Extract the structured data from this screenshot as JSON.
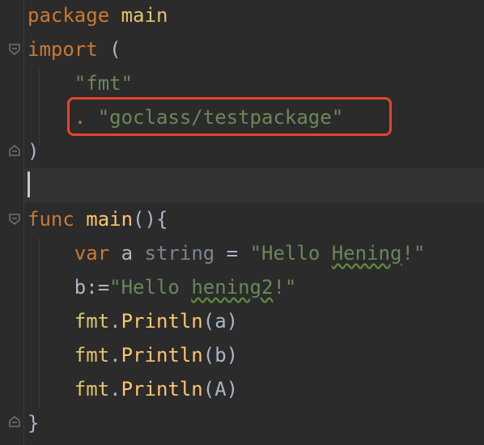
{
  "editor": {
    "language": "Go",
    "lines": {
      "l1": {
        "kw": "package",
        "name": "main"
      },
      "l2": {
        "kw": "import",
        "paren": "("
      },
      "l3": {
        "str": "\"fmt\""
      },
      "l4": {
        "dot": ".",
        "str": "\"goclass/testpackage\""
      },
      "l5": {
        "paren": ")"
      },
      "l7": {
        "kw": "func",
        "name": "main",
        "rest": "(){"
      },
      "l8": {
        "kw": "var",
        "name": "a",
        "type": "string",
        "op": "=",
        "str_a": "\"Hello ",
        "str_b": "Hening",
        "str_c": "!\""
      },
      "l9": {
        "pre": "b:=",
        "str_a": "\"Hello ",
        "str_b": "hening2",
        "str_c": "!\""
      },
      "l10": {
        "pkg": "fmt",
        "dot": ".",
        "fn": "Println",
        "args": "(a)"
      },
      "l11": {
        "pkg": "fmt",
        "dot": ".",
        "fn": "Println",
        "args": "(b)"
      },
      "l12": {
        "pkg": "fmt",
        "dot": ".",
        "fn": "Println",
        "args": "(A)"
      },
      "l13": {
        "paren": "}"
      }
    },
    "colors": {
      "background": "#2b2b2b",
      "keyword": "#cc7832",
      "string": "#6a8759",
      "function": "#ffc66d",
      "highlight_border": "#e8432f"
    }
  }
}
